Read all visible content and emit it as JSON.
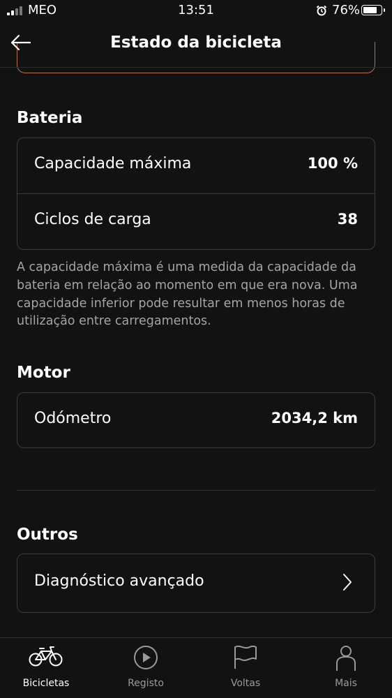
{
  "status_bar": {
    "carrier": "MEO",
    "time": "13:51",
    "battery_percent": "76%",
    "battery_level": 0.76
  },
  "nav": {
    "title": "Estado da bicicleta",
    "back_icon": "back-arrow-icon"
  },
  "battery_section": {
    "title": "Bateria",
    "rows": [
      {
        "label": "Capacidade máxima",
        "value": "100 %"
      },
      {
        "label": "Ciclos de carga",
        "value": "38"
      }
    ],
    "note": "A capacidade máxima é uma medida da capacidade da bateria em relação ao momento em que era nova. Uma capacidade inferior pode resultar em menos horas de utilização entre carregamentos."
  },
  "motor_section": {
    "title": "Motor",
    "rows": [
      {
        "label": "Odómetro",
        "value": "2034,2 km"
      }
    ]
  },
  "other_section": {
    "title": "Outros",
    "rows": [
      {
        "label": "Diagnóstico avançado",
        "icon": "chevron-right-icon"
      }
    ]
  },
  "tab_bar": {
    "active": "Bicicletas",
    "tabs": [
      {
        "label": "Bicicletas",
        "icon": "bicycle-icon"
      },
      {
        "label": "Registo",
        "icon": "play-circle-icon"
      },
      {
        "label": "Voltas",
        "icon": "flag-icon"
      },
      {
        "label": "Mais",
        "icon": "person-icon"
      }
    ]
  },
  "colors": {
    "background": "#121212",
    "card_border": "#3d3d3d",
    "accent_orange": "#b8734a",
    "muted_text": "#a5a5a5"
  }
}
